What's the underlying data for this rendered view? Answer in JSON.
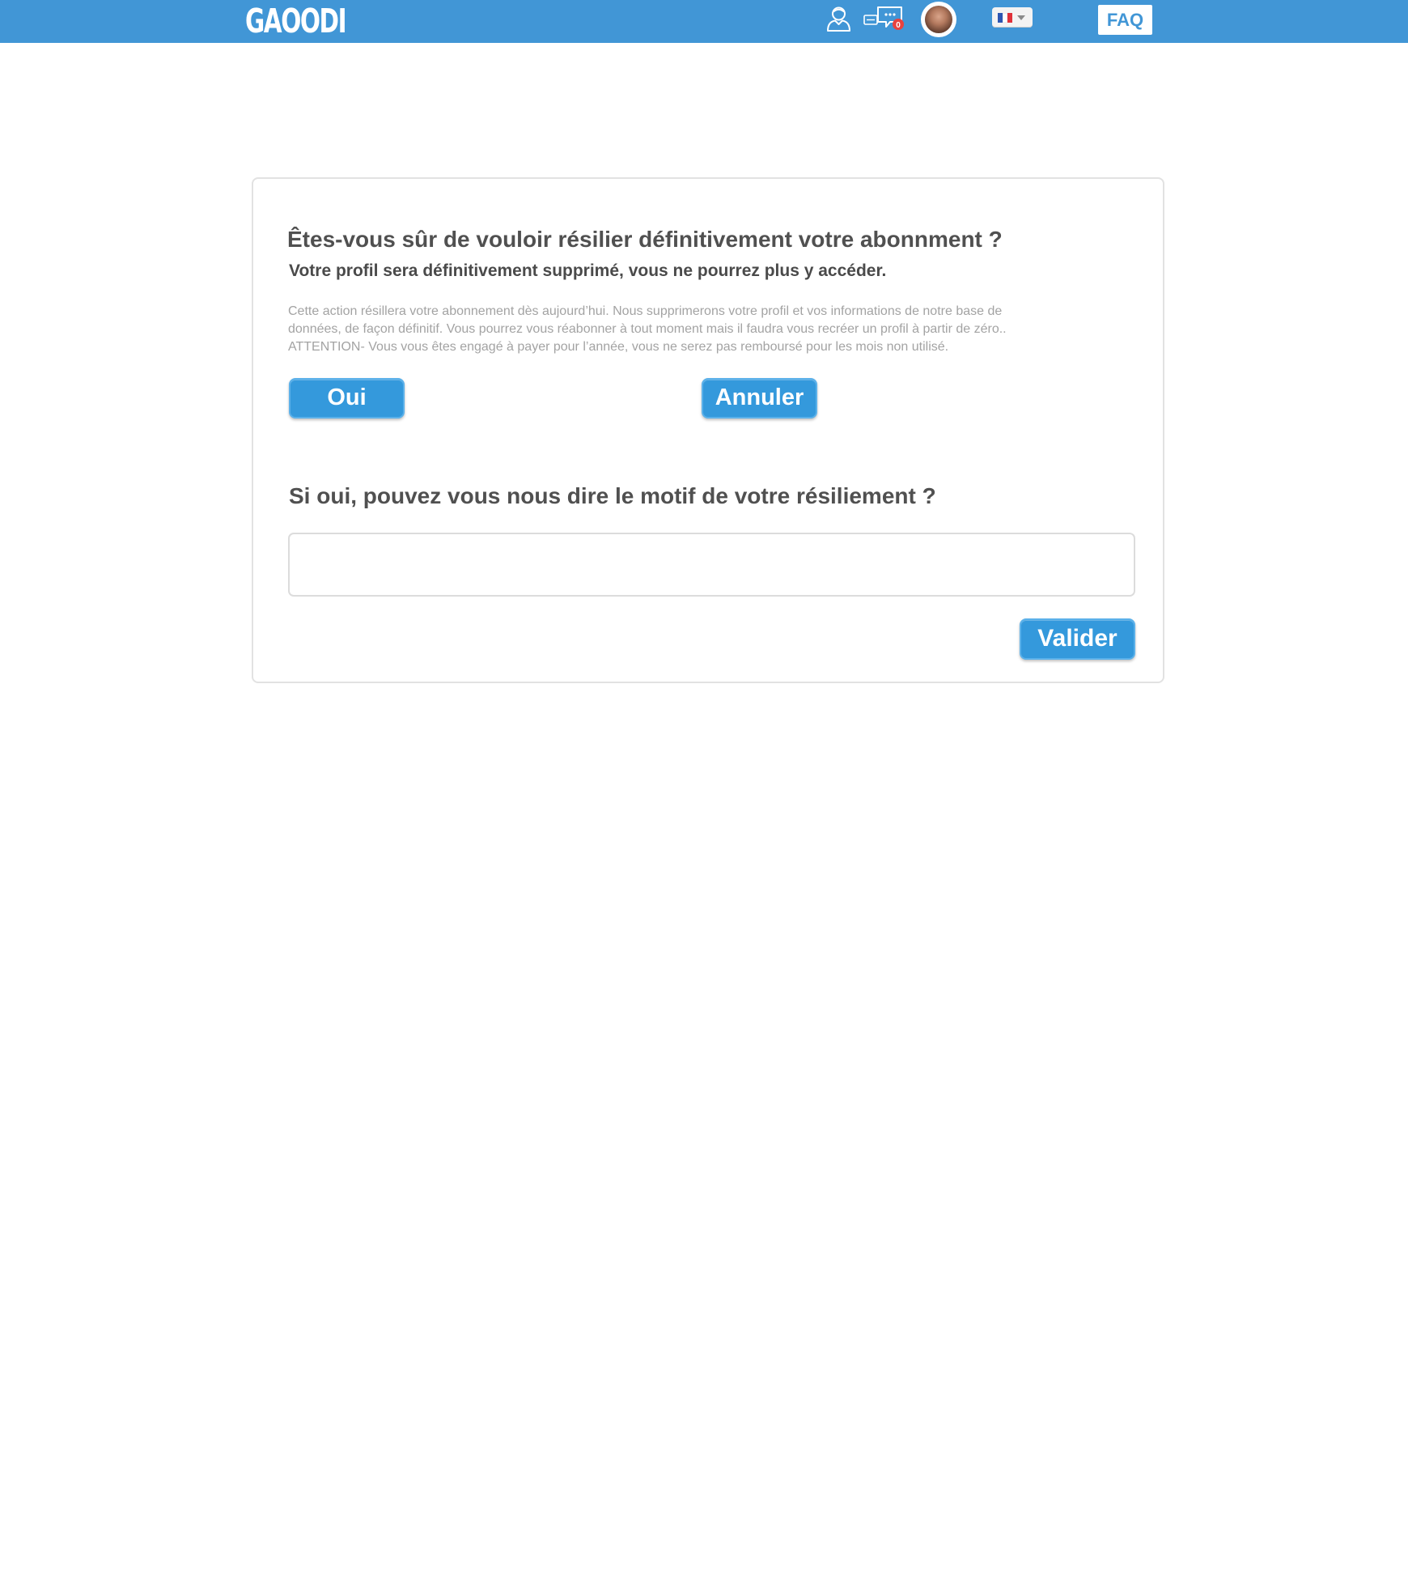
{
  "header": {
    "logo_text": "GAOODI",
    "notification_count": "0",
    "faq_label": "FAQ",
    "language": {
      "selected": "fr",
      "flag_colors": [
        "#2d56b2",
        "#ffffff",
        "#e0313a"
      ]
    },
    "icons": {
      "profile": "user-icon",
      "messages": "chat-icon",
      "avatar": "avatar",
      "dropdown": "chevron-down-icon"
    },
    "colors": {
      "bar": "#4196d6",
      "badge": "#e8423f"
    }
  },
  "dialog": {
    "title": "Êtes-vous sûr de vouloir résilier définitivement votre abonnment  ?",
    "subtitle": "Votre profil sera définitivement supprimé, vous ne pourrez plus y accéder.",
    "info_lines": [
      "Cette action résillera votre abonnement dès aujourd’hui. Nous supprimerons votre profil et vos informations de notre base de",
      "données, de façon définitif. Vous pourrez vous réabonner à tout moment mais il faudra vous  recréer un profil à partir de zéro..",
      "ATTENTION- Vous vous êtes engagé à payer pour l’année, vous ne serez pas remboursé pour les mois non utilisé."
    ],
    "yes_label": "Oui",
    "cancel_label": "Annuler",
    "reason_question": "Si oui, pouvez vous nous dire le motif de votre résiliement ?",
    "reason_value": "",
    "submit_label": "Valider",
    "accent_color": "#3499dc"
  }
}
